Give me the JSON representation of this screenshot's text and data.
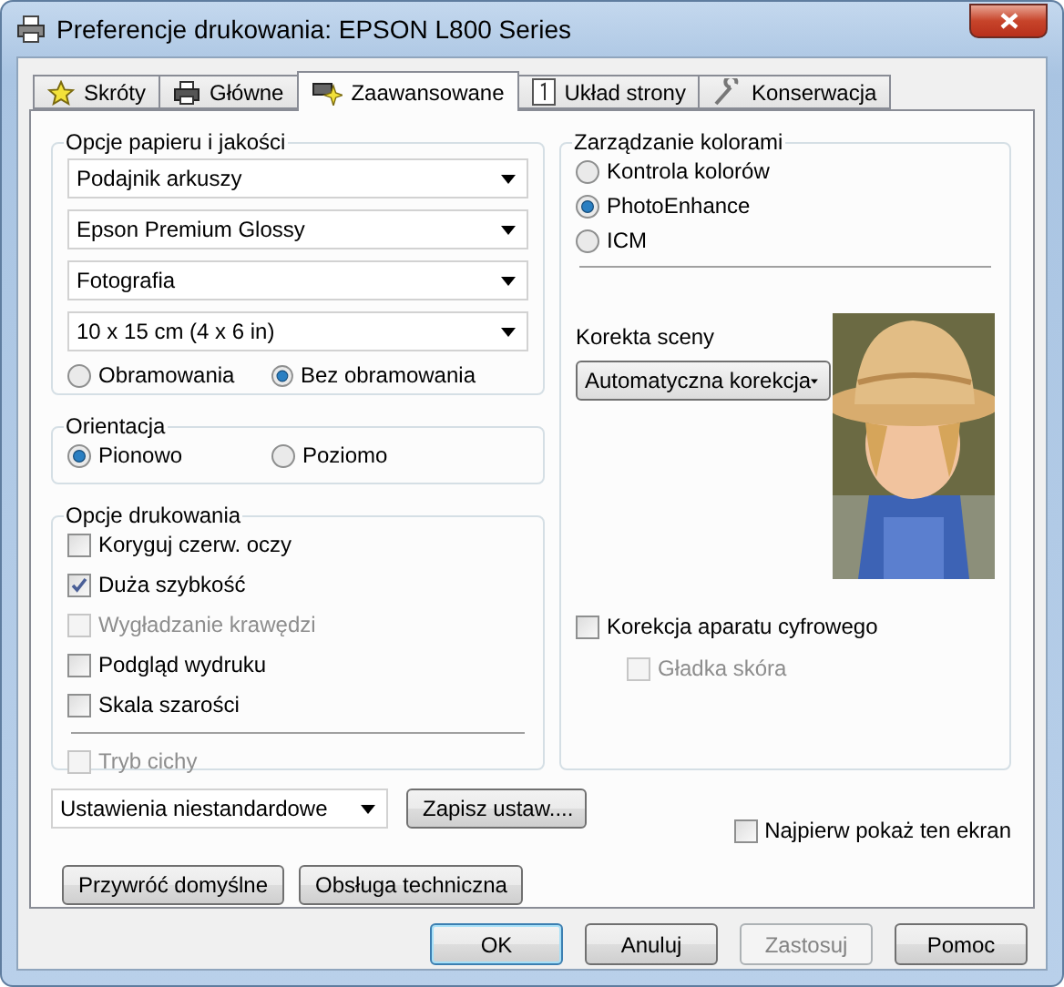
{
  "window": {
    "title": "Preferencje drukowania: EPSON L800 Series"
  },
  "tabs": [
    {
      "label": "Skróty",
      "selected": false
    },
    {
      "label": "Główne",
      "selected": false
    },
    {
      "label": "Zaawansowane",
      "selected": true
    },
    {
      "label": "Układ strony",
      "selected": false
    },
    {
      "label": "Konserwacja",
      "selected": false
    }
  ],
  "paper_quality": {
    "title": "Opcje papieru i jakości",
    "selects": [
      "Podajnik arkuszy",
      "Epson Premium Glossy",
      "Fotografia",
      "10 x 15 cm (4 x 6 in)"
    ],
    "border_options": [
      {
        "label": "Obramowania",
        "selected": false
      },
      {
        "label": "Bez obramowania",
        "selected": true
      }
    ]
  },
  "orientation": {
    "title": "Orientacja",
    "options": [
      {
        "label": "Pionowo",
        "selected": true
      },
      {
        "label": "Poziomo",
        "selected": false
      }
    ]
  },
  "print_options": {
    "title": "Opcje drukowania",
    "items": [
      {
        "label": "Koryguj czerw. oczy",
        "checked": false,
        "disabled": false
      },
      {
        "label": "Duża szybkość",
        "checked": true,
        "disabled": false
      },
      {
        "label": "Wygładzanie krawędzi",
        "checked": false,
        "disabled": true
      },
      {
        "label": "Podgląd wydruku",
        "checked": false,
        "disabled": false
      },
      {
        "label": "Skala szarości",
        "checked": false,
        "disabled": false
      }
    ],
    "quiet_mode": {
      "label": "Tryb cichy",
      "checked": false,
      "disabled": true
    }
  },
  "color_management": {
    "title": "Zarządzanie kolorami",
    "options": [
      {
        "label": "Kontrola kolorów",
        "selected": false
      },
      {
        "label": "PhotoEnhance",
        "selected": true
      },
      {
        "label": "ICM",
        "selected": false
      }
    ],
    "scene_label": "Korekta sceny",
    "scene_value": "Automatyczna korekcja",
    "camera_correction": {
      "label": "Korekcja aparatu cyfrowego",
      "checked": false,
      "disabled": false
    },
    "smooth_skin": {
      "label": "Gładka skóra",
      "checked": false,
      "disabled": true
    }
  },
  "settings_select": "Ustawienia niestandardowe",
  "save_button": "Zapisz ustaw....",
  "show_first": {
    "label": "Najpierw pokaż ten ekran",
    "checked": false
  },
  "actions": [
    "Przywróć domyślne",
    "Obsługa techniczna"
  ],
  "footer_buttons": [
    {
      "label": "OK",
      "default": true,
      "disabled": false
    },
    {
      "label": "Anuluj",
      "default": false,
      "disabled": false
    },
    {
      "label": "Zastosuj",
      "default": false,
      "disabled": true
    },
    {
      "label": "Pomoc",
      "default": false,
      "disabled": false
    }
  ]
}
